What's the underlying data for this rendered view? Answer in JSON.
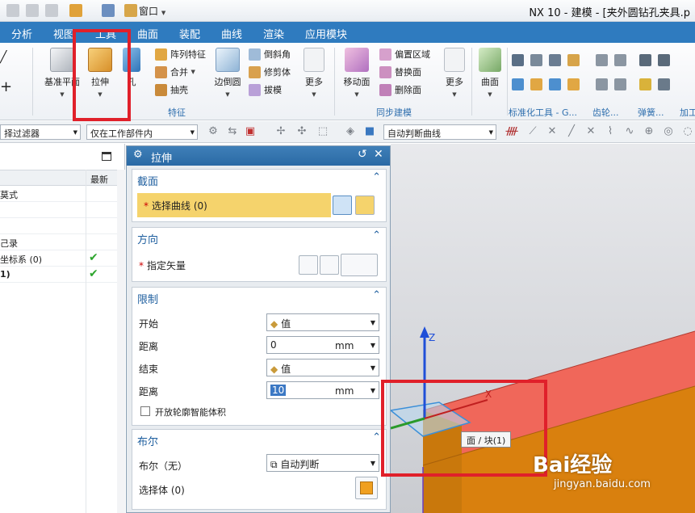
{
  "app": {
    "title": "NX 10 - 建模 - [夹外圆钻孔夹具.p",
    "window_menu": "窗口"
  },
  "menu_tabs": [
    "分析",
    "视图",
    "工具",
    "曲面",
    "装配",
    "曲线",
    "渲染",
    "应用模块"
  ],
  "ribbon": {
    "datum_plane": "基准平面",
    "extrude": "拉伸",
    "hole": "孔",
    "pattern_feature": "阵列特征",
    "unite": "合并",
    "shell": "抽壳",
    "edge_blend": "边倒圆",
    "chamfer": "倒斜角",
    "trim_body": "修剪体",
    "draft": "拔模",
    "more1": "更多",
    "move_face": "移动面",
    "offset_region": "偏置区域",
    "replace_face": "替换面",
    "delete_face": "删除面",
    "more2": "更多",
    "surface": "曲面",
    "group_feature": "特征",
    "group_sync": "同步建模",
    "group_std": "标准化工具 - G...",
    "group_gear": "齿轮...",
    "group_spring": "弹簧...",
    "group_machining": "加工"
  },
  "filterbar": {
    "type_filter": "择过滤器",
    "scope": "仅在工作部件内",
    "curve_rule": "自动判断曲线"
  },
  "navigator": {
    "col_latest": "最新",
    "rows": [
      {
        "label": "莫式",
        "check": false
      },
      {
        "label": "",
        "check": false
      },
      {
        "label": "",
        "check": false
      },
      {
        "label": "己录",
        "check": false
      },
      {
        "label": "坐标系 (0)",
        "check": true
      },
      {
        "label": "1)",
        "check": true
      }
    ]
  },
  "dialog": {
    "title": "拉伸",
    "section_curve": {
      "title": "截面",
      "select_curve": "选择曲线 (0)"
    },
    "section_direction": {
      "title": "方向",
      "specify_vector": "指定矢量"
    },
    "section_limits": {
      "title": "限制",
      "start_label": "开始",
      "start_value": "值",
      "distance1_label": "距离",
      "distance1_value": "0",
      "distance1_unit": "mm",
      "end_label": "结束",
      "end_value": "值",
      "distance2_label": "距离",
      "distance2_value": "10",
      "distance2_unit": "mm",
      "open_profile": "开放轮廓智能体积"
    },
    "section_boolean": {
      "title": "布尔",
      "boolean_label": "布尔（无）",
      "boolean_value": "自动判断",
      "select_body": "选择体 (0)"
    }
  },
  "viewport": {
    "axis_z": "Z",
    "axis_x": "X",
    "tooltip": "面 / 块(1)"
  },
  "watermark": {
    "brand": "Bai经验",
    "url": "jingyan.baidu.com"
  }
}
